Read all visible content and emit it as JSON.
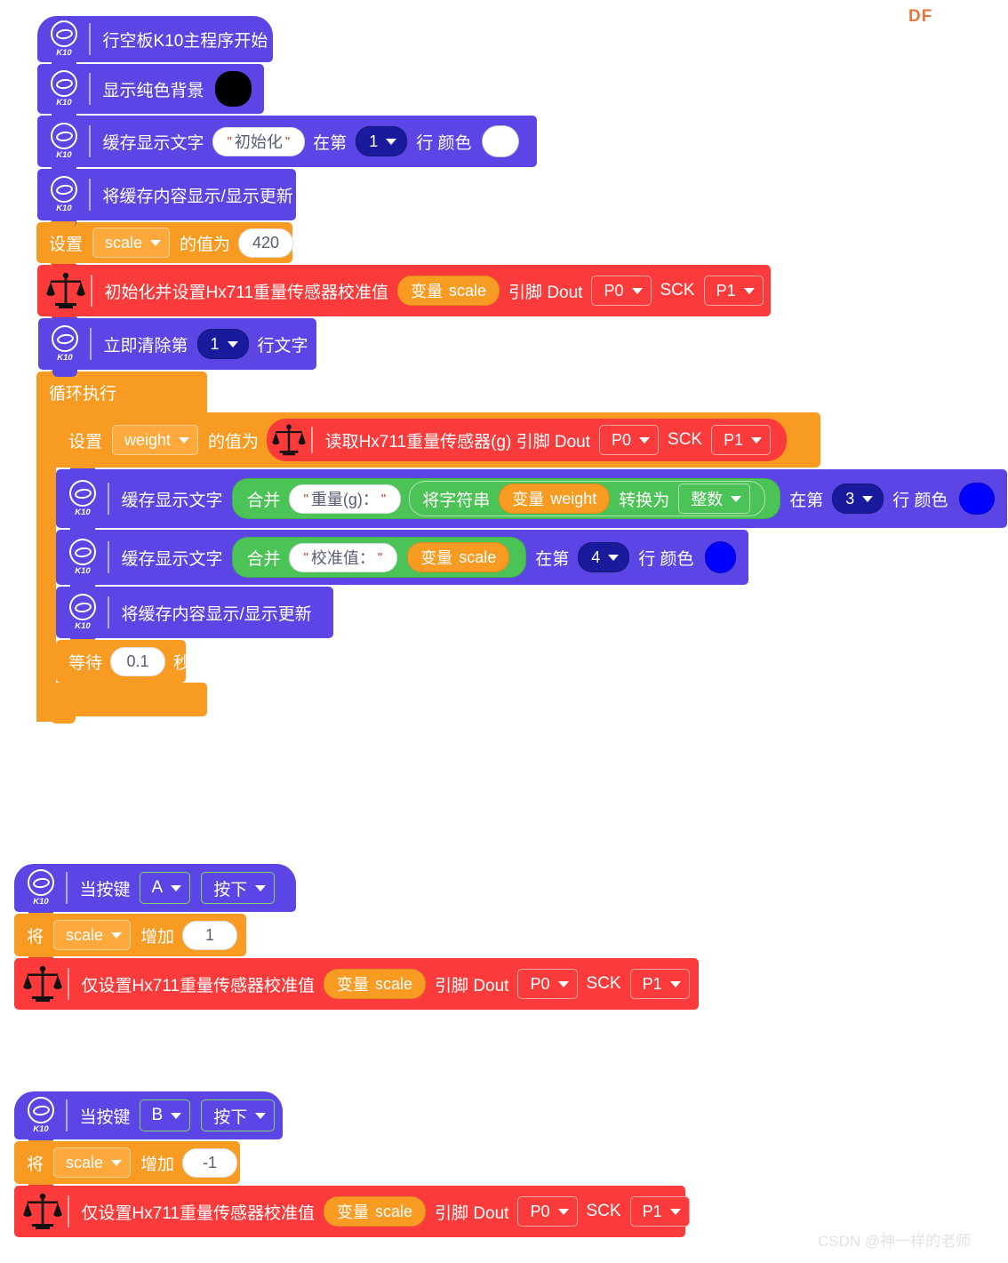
{
  "watermarks": {
    "brand": "DF",
    "credit": "CSDN @神一样的老师"
  },
  "icons": {
    "k10_label": "K10",
    "k10_name": "k10-board-icon",
    "scale_name": "balance-scale-icon",
    "caret_name": "chevron-down-icon"
  },
  "scripts": [
    {
      "id": "main",
      "blocks": {
        "start": {
          "label": "行空板K10主程序开始"
        },
        "bg": {
          "label": "显示纯色背景",
          "color": "#000000"
        },
        "cache_text_init": {
          "label": "缓存显示文字",
          "text": "初始化",
          "at": "在第",
          "line": "1",
          "line_suffix": "行 颜色",
          "color": "#ffffff"
        },
        "refresh_1": {
          "label": "将缓存内容显示/显示更新"
        },
        "set_scale": {
          "label": "设置",
          "var": "scale",
          "mid": "的值为",
          "value": "420"
        },
        "hx711_init": {
          "label": "初始化并设置Hx711重量传感器校准值",
          "var_prefix": "变量",
          "var": "scale",
          "pin_label": "引脚 Dout",
          "dout": "P0",
          "sck_label": "SCK",
          "sck": "P1"
        },
        "clear_line": {
          "prefix": "立即清除第",
          "line": "1",
          "suffix": "行文字"
        },
        "loop": {
          "label": "循环执行"
        },
        "set_weight": {
          "label": "设置",
          "var": "weight",
          "mid": "的值为",
          "reporter": {
            "label": "读取Hx711重量传感器(g) 引脚 Dout",
            "dout": "P0",
            "sck_label": "SCK",
            "sck": "P1"
          }
        },
        "cache_text_weight": {
          "label": "缓存显示文字",
          "join": "合并",
          "text": "重量(g)：",
          "convert_prefix": "将字符串",
          "var_prefix": "变量",
          "var": "weight",
          "convert_mid": "转换为",
          "convert_type": "整数",
          "at": "在第",
          "line": "3",
          "line_suffix": "行 颜色",
          "color": "#0000ff"
        },
        "cache_text_cal": {
          "label": "缓存显示文字",
          "join": "合并",
          "text": "校准值：",
          "var_prefix": "变量",
          "var": "scale",
          "at": "在第",
          "line": "4",
          "line_suffix": "行 颜色",
          "color": "#0000ff"
        },
        "refresh_2": {
          "label": "将缓存内容显示/显示更新"
        },
        "wait": {
          "prefix": "等待",
          "value": "0.1",
          "suffix": "秒"
        }
      }
    },
    {
      "id": "button_a",
      "blocks": {
        "hat": {
          "prefix": "当按键",
          "key": "A",
          "action": "按下"
        },
        "change": {
          "prefix": "将",
          "var": "scale",
          "mid": "增加",
          "value": "1"
        },
        "hx711_set": {
          "label": "仅设置Hx711重量传感器校准值",
          "var_prefix": "变量",
          "var": "scale",
          "pin_label": "引脚 Dout",
          "dout": "P0",
          "sck_label": "SCK",
          "sck": "P1"
        }
      }
    },
    {
      "id": "button_b",
      "blocks": {
        "hat": {
          "prefix": "当按键",
          "key": "B",
          "action": "按下"
        },
        "change": {
          "prefix": "将",
          "var": "scale",
          "mid": "增加",
          "value": "-1"
        },
        "hx711_set": {
          "label": "仅设置Hx711重量传感器校准值",
          "var_prefix": "变量",
          "var": "scale",
          "pin_label": "引脚 Dout",
          "dout": "P0",
          "sck_label": "SCK",
          "sck": "P1"
        }
      }
    }
  ],
  "palette": {
    "purple": "#5b46e5",
    "orange": "#f89b22",
    "red": "#fb3b3b",
    "green": "#4cc356",
    "navy_dropdown": "#1a1a9c"
  }
}
